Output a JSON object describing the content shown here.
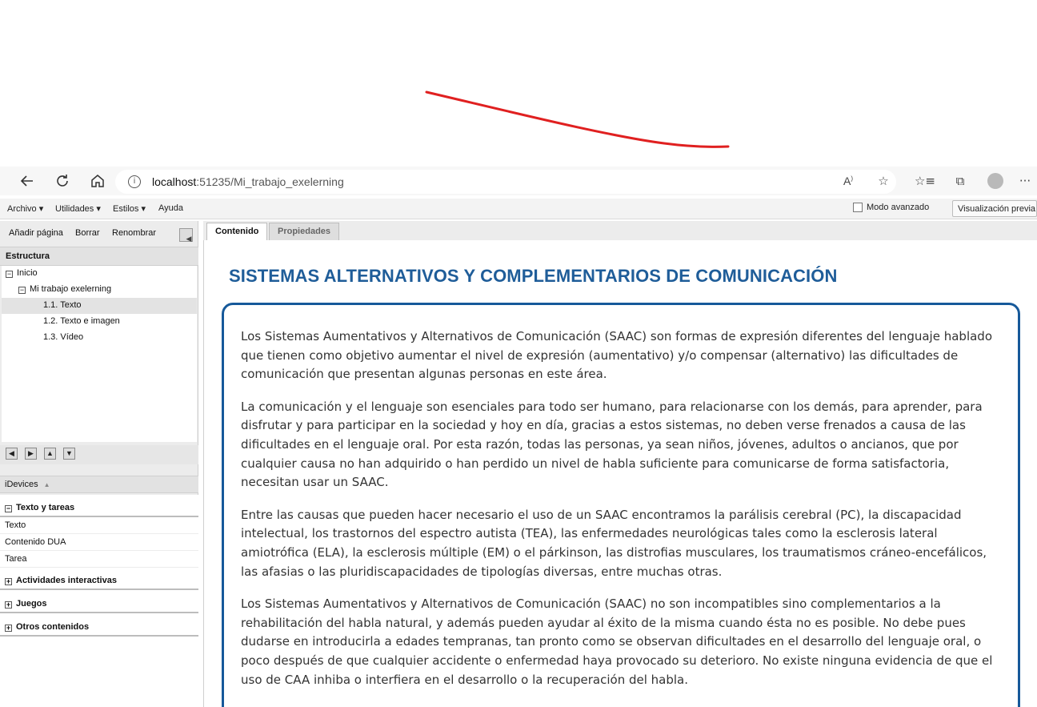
{
  "browser": {
    "url_host": "localhost",
    "url_path": ":51235/Mi_trabajo_exelerning"
  },
  "menu": {
    "items": [
      "Archivo ▾",
      "Utilidades ▾",
      "Estilos ▾",
      "Ayuda"
    ],
    "advanced_mode": "Modo avanzado",
    "preview": "Visualización previa"
  },
  "left": {
    "toolbar": [
      "Añadir página",
      "Borrar",
      "Renombrar"
    ],
    "structure_title": "Estructura",
    "tree": [
      {
        "label": "Inicio"
      },
      {
        "label": "Mi trabajo exelerning"
      },
      {
        "label": "1.1. Texto"
      },
      {
        "label": "1.2. Texto e imagen"
      },
      {
        "label": "1.3. Vídeo"
      }
    ],
    "idevices_title": "iDevices",
    "categories": [
      {
        "label": "Texto y tareas"
      },
      {
        "label": "Actividades interactivas"
      },
      {
        "label": "Juegos"
      },
      {
        "label": "Otros contenidos"
      }
    ],
    "sub_items": [
      "Texto",
      "Contenido DUA",
      "Tarea"
    ]
  },
  "tabs": [
    "Contenido",
    "Propiedades"
  ],
  "content": {
    "title": "SISTEMAS ALTERNATIVOS Y COMPLEMENTARIOS DE COMUNICACIÓN",
    "paragraphs": [
      "Los Sistemas Aumentativos y Alternativos de Comunicación (SAAC) son formas de expresión diferentes del lenguaje hablado que tienen como objetivo aumentar el nivel de expresión (aumentativo) y/o compensar (alternativo) las dificultades de comunicación que presentan algunas personas en este área.",
      "La comunicación y el lenguaje son esenciales para todo ser humano, para relacionarse con los demás, para aprender, para disfrutar y para participar en la sociedad y hoy en día, gracias a estos sistemas, no deben verse frenados a causa de las dificultades en el lenguaje oral. Por esta razón, todas las personas, ya sean niños, jóvenes, adultos o ancianos, que por cualquier causa no han adquirido o han perdido un nivel de habla suficiente para comunicarse de forma satisfactoria, necesitan usar un SAAC.",
      "Entre las causas que pueden hacer necesario el uso de un SAAC encontramos la parálisis cerebral (PC), la discapacidad intelectual, los trastornos del espectro autista (TEA), las enfermedades neurológicas tales como la esclerosis lateral amiotrófica (ELA), la esclerosis múltiple (EM) o el párkinson, las distrofias musculares, los traumatismos cráneo-encefálicos, las afasias o las pluridiscapacidades de tipologías diversas, entre muchas otras.",
      "Los Sistemas Aumentativos y Alternativos de Comunicación (SAAC) no son incompatibles sino complementarios a la rehabilitación del habla natural, y además pueden ayudar al éxito de la misma cuando ésta no es posible. No debe pues dudarse en introducirla a edades tempranas, tan pronto como se observan dificultades en el desarrollo del lenguaje oral, o poco después de que cualquier accidente o enfermedad haya provocado su deterioro. No existe ninguna evidencia de que el uso de CAA inhiba o interfiera en el desarrollo o la recuperación del habla."
    ]
  },
  "colors": {
    "accent": "#1f5d99",
    "frame": "#16599a",
    "annotation": "#e02020"
  }
}
